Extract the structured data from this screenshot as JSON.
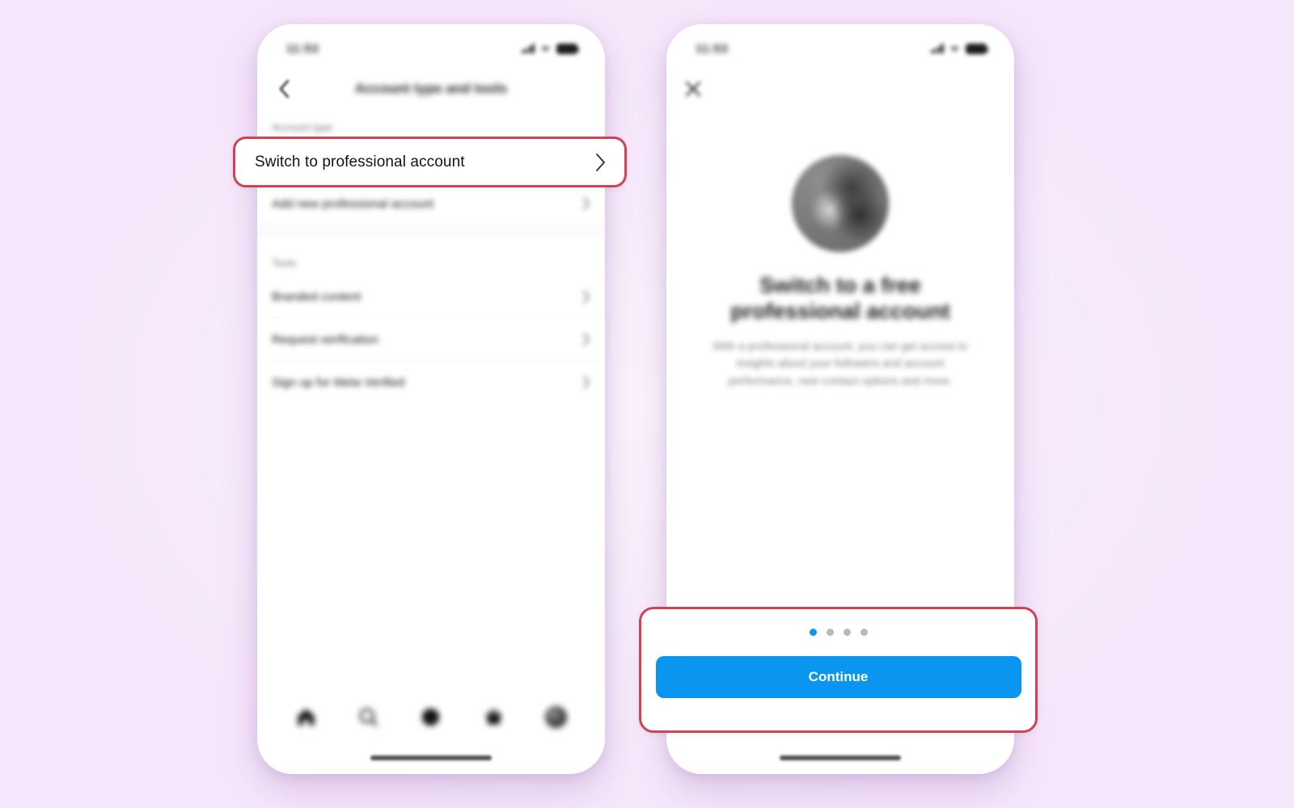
{
  "page": {
    "background_color": "#f6e6fb",
    "highlight_color": "#cf4357",
    "accent_color": "#0a95f0"
  },
  "left_phone": {
    "status_bar": {
      "time": "11:53",
      "signal_icon": "cellular-signal-icon",
      "wifi_icon": "wifi-icon",
      "battery_icon": "battery-icon"
    },
    "nav": {
      "back_icon": "chevron-left-icon",
      "title": "Account type and tools"
    },
    "sections": [
      {
        "label": "Account type",
        "rows": [
          {
            "label": "Switch to professional account",
            "highlighted": true,
            "chevron": "chevron-right-icon"
          },
          {
            "label": "Add new professional account",
            "highlighted": false,
            "chevron": "chevron-right-icon"
          }
        ]
      },
      {
        "label": "Tools",
        "rows": [
          {
            "label": "Branded content",
            "highlighted": false,
            "chevron": "chevron-right-icon"
          },
          {
            "label": "Request verification",
            "highlighted": false,
            "chevron": "chevron-right-icon"
          },
          {
            "label": "Sign up for Meta Verified",
            "highlighted": false,
            "chevron": "chevron-right-icon"
          }
        ]
      }
    ],
    "tab_bar": [
      {
        "name": "home-icon",
        "label": "Home"
      },
      {
        "name": "search-icon",
        "label": "Search"
      },
      {
        "name": "reels-icon",
        "label": "Reels"
      },
      {
        "name": "shop-icon",
        "label": "Shop"
      },
      {
        "name": "profile-avatar",
        "label": "Profile"
      }
    ]
  },
  "right_phone": {
    "status_bar": {
      "time": "11:53",
      "signal_icon": "cellular-signal-icon",
      "wifi_icon": "wifi-icon",
      "battery_icon": "battery-icon"
    },
    "nav": {
      "close_icon": "close-icon"
    },
    "onboarding": {
      "avatar": "profile-photo",
      "title": "Switch to a free professional account",
      "body": "With a professional account, you can get access to insights about your followers and account performance, new contact options and more."
    },
    "footer": {
      "pager": {
        "total": 4,
        "active_index": 0
      },
      "continue_label": "Continue"
    }
  }
}
